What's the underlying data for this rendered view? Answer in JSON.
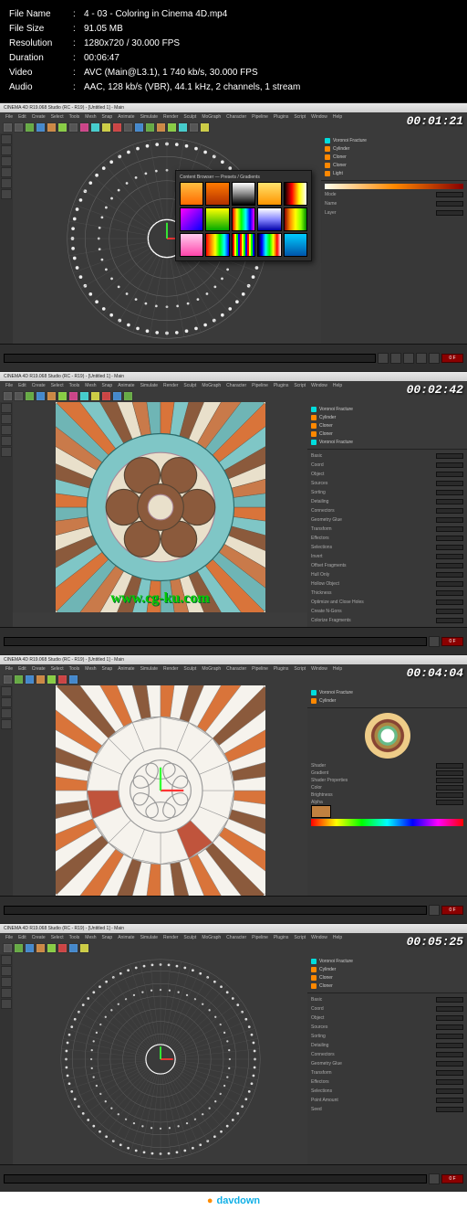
{
  "meta": {
    "labels": {
      "file_name": "File Name",
      "file_size": "File Size",
      "resolution": "Resolution",
      "duration": "Duration",
      "video": "Video",
      "audio": "Audio"
    },
    "file_name": "4 - 03 - Coloring in Cinema 4D.mp4",
    "file_size": "91.05 MB",
    "resolution": "1280x720 / 30.000 FPS",
    "duration": "00:06:47",
    "video": "AVC (Main@L3.1), 1 740 kb/s, 30.000 FPS",
    "audio": "AAC, 128 kb/s (VBR), 44.1 kHz, 2 channels, 1 stream"
  },
  "frames": [
    {
      "title": "CINEMA 4D R19.068 Studio (RC - R19) - [Untitled 1] - Main",
      "timestamp": "00:01:21",
      "menu": [
        "File",
        "Edit",
        "Create",
        "Select",
        "Tools",
        "Mesh",
        "Snap",
        "Animate",
        "Simulate",
        "Render",
        "Sculpt",
        "MoGraph",
        "Character",
        "Pipeline",
        "Plugins",
        "Script",
        "Window",
        "Help"
      ],
      "tree": [
        [
          "Voronoi Fracture",
          "cyan"
        ],
        [
          "Cylinder",
          "or"
        ],
        [
          "Cloner",
          "or"
        ],
        [
          "Cloner",
          "or"
        ],
        [
          "Light",
          "or"
        ]
      ],
      "attrs": [
        "Mode",
        "Name",
        "Layer"
      ],
      "preset_header": "Content Browser — Presets / Gradients",
      "timeline_frame": "0 F"
    },
    {
      "title": "CINEMA 4D R19.068 Studio (RC - R19) - [Untitled 1] - Main",
      "timestamp": "00:02:42",
      "menu": [
        "File",
        "Edit",
        "Create",
        "Select",
        "Tools",
        "Mesh",
        "Snap",
        "Animate",
        "Simulate",
        "Render",
        "Sculpt",
        "MoGraph",
        "Character",
        "Pipeline",
        "Plugins",
        "Script",
        "Window",
        "Help"
      ],
      "tree": [
        [
          "Voronoi Fracture",
          "cyan"
        ],
        [
          "Cylinder",
          "or"
        ],
        [
          "Cloner",
          "or"
        ],
        [
          "Cloner",
          "or"
        ],
        [
          "Voronoi Fracture",
          "cyan"
        ]
      ],
      "attrs": [
        "Basic",
        "Coord",
        "Object",
        "Sources",
        "Sorting",
        "Detailing",
        "Connectors",
        "Geometry Glue",
        "Transform",
        "Effectors",
        "Selections"
      ],
      "more": [
        "Invert",
        "Offset Fragments",
        "Hull Only",
        "Hollow Object",
        "Thickness",
        "Optimize and Close Holes",
        "Create N-Gons",
        "Colorize Fragments"
      ],
      "timeline_frame": "0 F"
    },
    {
      "title": "CINEMA 4D R19.068 Studio (RC - R19) - [Untitled 1] - Main",
      "timestamp": "00:04:04",
      "menu": [
        "File",
        "Edit",
        "Create",
        "Select",
        "Tools",
        "Mesh",
        "Snap",
        "Animate",
        "Simulate",
        "Render",
        "Sculpt",
        "MoGraph",
        "Character",
        "Pipeline",
        "Plugins",
        "Script",
        "Window",
        "Help"
      ],
      "tree": [
        [
          "Voronoi Fracture",
          "cyan"
        ],
        [
          "Cylinder",
          "or"
        ]
      ],
      "attrs": [
        "Shader",
        "Gradient",
        "Shader Properties",
        "Color",
        "Brightness",
        "Alpha"
      ],
      "timeline_frame": "0 F"
    },
    {
      "title": "CINEMA 4D R19.068 Studio (RC - R19) - [Untitled 1] - Main",
      "timestamp": "00:05:25",
      "menu": [
        "File",
        "Edit",
        "Create",
        "Select",
        "Tools",
        "Mesh",
        "Snap",
        "Animate",
        "Simulate",
        "Render",
        "Sculpt",
        "MoGraph",
        "Character",
        "Pipeline",
        "Plugins",
        "Script",
        "Window",
        "Help"
      ],
      "tree": [
        [
          "Voronoi Fracture",
          "cyan"
        ],
        [
          "Cylinder",
          "or"
        ],
        [
          "Cloner",
          "or"
        ],
        [
          "Cloner",
          "or"
        ]
      ],
      "attrs": [
        "Basic",
        "Coord",
        "Object",
        "Sources",
        "Sorting",
        "Detailing",
        "Connectors",
        "Geometry Glue",
        "Transform",
        "Effectors",
        "Selections"
      ],
      "more": [
        "Point Amount",
        "Seed"
      ],
      "timeline_frame": "0 F"
    }
  ],
  "gradient_presets": [
    "linear-gradient(#ffbf40,#ff6a00)",
    "linear-gradient(#ff7a00,#b33000)",
    "linear-gradient(#fff,#888,#000)",
    "linear-gradient(#ffe36e,#ff9500)",
    "linear-gradient(90deg,#000,#f00,#ff0,#fff)",
    "linear-gradient(135deg,#f0f,#00f)",
    "linear-gradient(#ff0,#0a0)",
    "linear-gradient(90deg,#f00,#ff0,#0f0,#0ff,#00f,#f0f)",
    "linear-gradient(#fff,#88f,#00a)",
    "linear-gradient(90deg,#800,#f80,#ff0,#8f0,#080)",
    "linear-gradient(#fce,#f4a)",
    "linear-gradient(90deg,#f00,#ff8000,#ff0,#0f0,#0ff,#00f)",
    "repeating-linear-gradient(90deg,#f00 0 2px,#ff0 2px 4px,#0f0 4px 6px,#00f 6px 8px)",
    "linear-gradient(90deg,#000,#00f,#0ff,#0f0,#ff0,#f00,#fff)",
    "linear-gradient(#0cf,#05a)"
  ],
  "watermark": "www.cg-ku.com",
  "davdown": "davdown"
}
